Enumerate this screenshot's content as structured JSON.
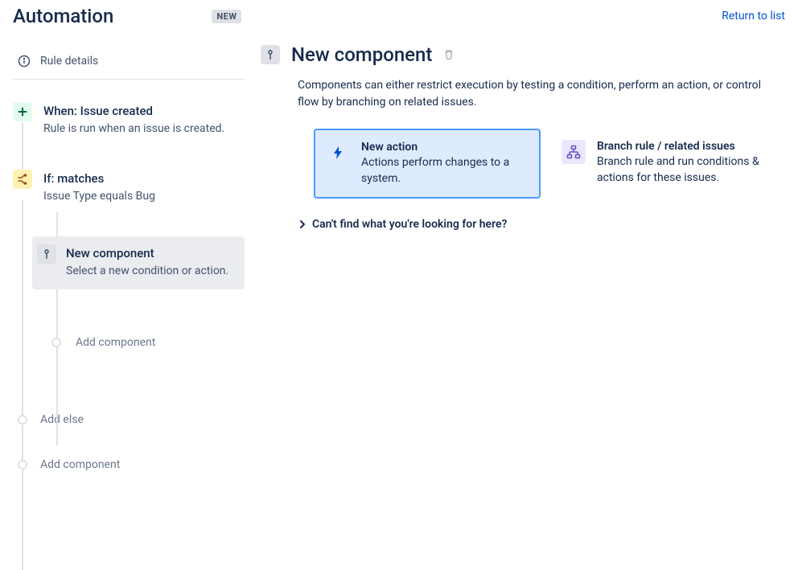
{
  "header": {
    "title": "Automation",
    "badge": "NEW",
    "return_link": "Return to list"
  },
  "sidebar": {
    "rule_details": "Rule details",
    "steps": {
      "trigger": {
        "title": "When: Issue created",
        "desc": "Rule is run when an issue is created."
      },
      "condition": {
        "title": "If: matches",
        "desc": "Issue Type equals Bug"
      },
      "new_component": {
        "title": "New component",
        "desc": "Select a new condition or action."
      },
      "add_component_nested": "Add component",
      "add_else": "Add else",
      "add_component": "Add component"
    }
  },
  "main": {
    "title": "New component",
    "description": "Components can either restrict execution by testing a condition, perform an action, or control flow by branching on related issues.",
    "cards": {
      "action": {
        "title": "New action",
        "desc": "Actions perform changes to a system."
      },
      "branch": {
        "title": "Branch rule / related issues",
        "desc": "Branch rule and run conditions & actions for these issues."
      }
    },
    "expander": "Can't find what you're looking for here?"
  }
}
